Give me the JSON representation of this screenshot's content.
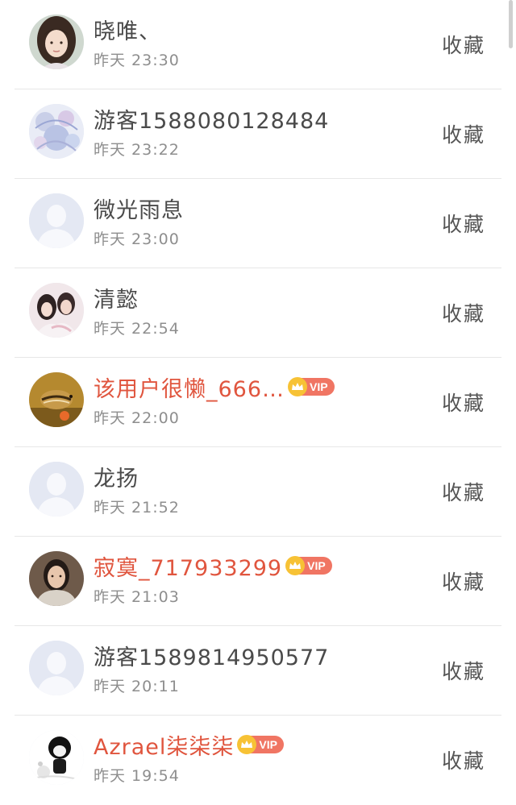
{
  "list": [
    {
      "name": "晓唯、",
      "time": "昨天 23:30",
      "action": "收藏",
      "avatar": "photo-avatar-portrait",
      "vip": false
    },
    {
      "name": "游客1588080128484",
      "time": "昨天 23:22",
      "action": "收藏",
      "avatar": "photo-avatar-illustration",
      "vip": false
    },
    {
      "name": "微光雨息",
      "time": "昨天 23:00",
      "action": "收藏",
      "avatar": "default-avatar",
      "vip": false
    },
    {
      "name": "清懿",
      "time": "昨天 22:54",
      "action": "收藏",
      "avatar": "photo-avatar-couple",
      "vip": false
    },
    {
      "name": "该用户很懒_666…",
      "time": "昨天 22:00",
      "action": "收藏",
      "avatar": "photo-avatar-chipmunk",
      "vip": true,
      "vip_label": "VIP"
    },
    {
      "name": "龙扬",
      "time": "昨天 21:52",
      "action": "收藏",
      "avatar": "default-avatar",
      "vip": false
    },
    {
      "name": "寂寞_717933299",
      "time": "昨天 21:03",
      "action": "收藏",
      "avatar": "photo-avatar-woman",
      "vip": true,
      "vip_label": "VIP"
    },
    {
      "name": "游客1589814950577",
      "time": "昨天 20:11",
      "action": "收藏",
      "avatar": "default-avatar",
      "vip": false
    },
    {
      "name": "Azrael柒柒柒",
      "time": "昨天 19:54",
      "action": "收藏",
      "avatar": "photo-avatar-cartoon",
      "vip": true,
      "vip_label": "VIP"
    }
  ],
  "colors": {
    "vip_name": "#e0553e",
    "vip_badge": "#f07563",
    "crown": "#f7c235",
    "name": "#4a4a4a",
    "time": "#8e8e8e"
  }
}
